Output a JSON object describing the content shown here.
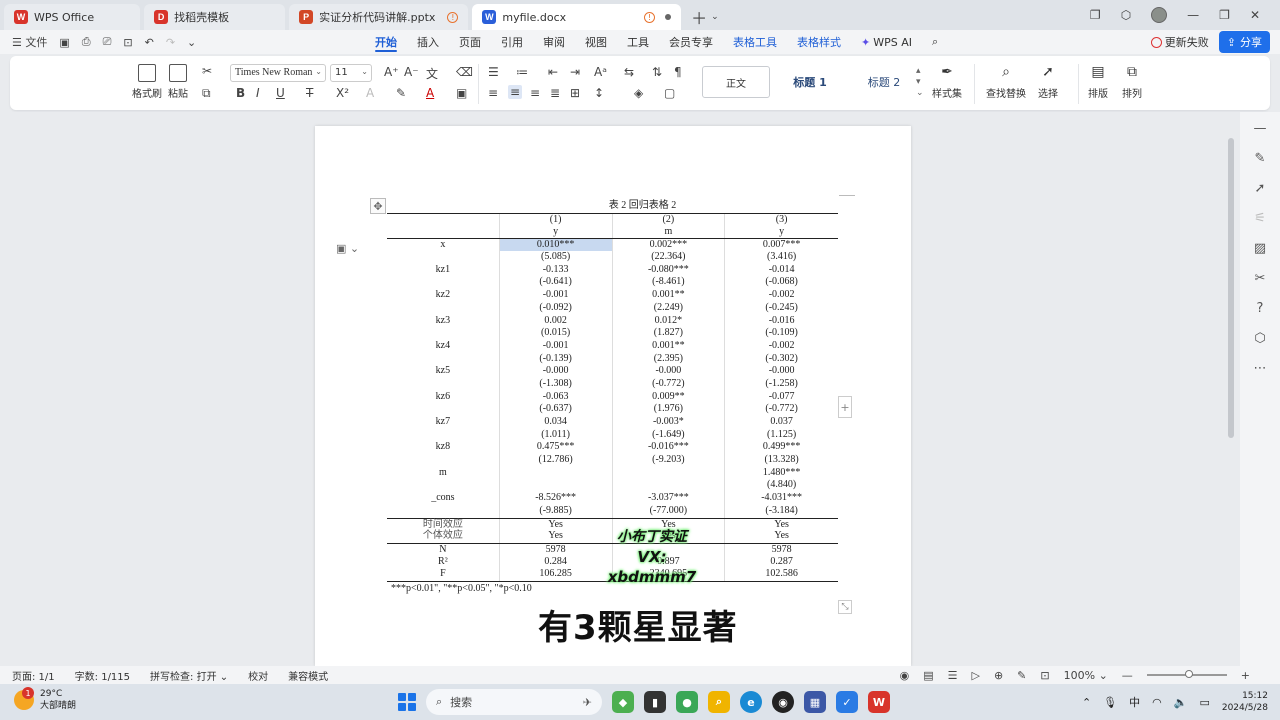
{
  "tabs": [
    {
      "label": "WPS Office",
      "logo": "W",
      "logo_color": "#d8342b",
      "active": false
    },
    {
      "label": "找稻壳模板",
      "logo": "D",
      "logo_color": "#d8342b",
      "active": false
    },
    {
      "label": "实证分析代码讲解.pptx",
      "logo": "P",
      "logo_color": "#d24726",
      "active": false
    },
    {
      "label": "myfile.docx",
      "logo": "W",
      "logo_color": "#2b5fd9",
      "active": true
    }
  ],
  "menu": {
    "file": "文件",
    "tabs": [
      "开始",
      "插入",
      "页面",
      "引用",
      "审阅",
      "视图",
      "工具",
      "会员专享",
      "表格工具",
      "表格样式"
    ],
    "wps_ai": "WPS AI",
    "sync_status": "更新失败",
    "share": "分享"
  },
  "ribbon": {
    "format_painter": "格式刷",
    "paste": "粘贴",
    "font_name": "Times New Roman",
    "font_size": "11",
    "styles": [
      "正文",
      "标题 1",
      "标题 2"
    ],
    "style_set": "样式集",
    "find_replace": "查找替换",
    "select": "选择",
    "layout": "排版",
    "arrange": "排列"
  },
  "table": {
    "title": "表 2 回归表格 2",
    "col_nums": [
      "(1)",
      "(2)",
      "(3)"
    ],
    "dep_vars": [
      "y",
      "m",
      "y"
    ],
    "rows": [
      {
        "label": "x",
        "v": [
          "0.010***",
          "0.002***",
          "0.007***"
        ],
        "t": [
          "(5.085)",
          "(22.364)",
          "(3.416)"
        ]
      },
      {
        "label": "kz1",
        "v": [
          "-0.133",
          "-0.080***",
          "-0.014"
        ],
        "t": [
          "(-0.641)",
          "(-8.461)",
          "(-0.068)"
        ]
      },
      {
        "label": "kz2",
        "v": [
          "-0.001",
          "0.001**",
          "-0.002"
        ],
        "t": [
          "(-0.092)",
          "(2.249)",
          "(-0.245)"
        ]
      },
      {
        "label": "kz3",
        "v": [
          "0.002",
          "0.012*",
          "-0.016"
        ],
        "t": [
          "(0.015)",
          "(1.827)",
          "(-0.109)"
        ]
      },
      {
        "label": "kz4",
        "v": [
          "-0.001",
          "0.001**",
          "-0.002"
        ],
        "t": [
          "(-0.139)",
          "(2.395)",
          "(-0.302)"
        ]
      },
      {
        "label": "kz5",
        "v": [
          "-0.000",
          "-0.000",
          "-0.000"
        ],
        "t": [
          "(-1.308)",
          "(-0.772)",
          "(-1.258)"
        ]
      },
      {
        "label": "kz6",
        "v": [
          "-0.063",
          "0.009**",
          "-0.077"
        ],
        "t": [
          "(-0.637)",
          "(1.976)",
          "(-0.772)"
        ]
      },
      {
        "label": "kz7",
        "v": [
          "0.034",
          "-0.003*",
          "0.037"
        ],
        "t": [
          "(1.011)",
          "(-1.649)",
          "(1.125)"
        ]
      },
      {
        "label": "kz8",
        "v": [
          "0.475***",
          "-0.016***",
          "0.499***"
        ],
        "t": [
          "(12.786)",
          "(-9.203)",
          "(13.328)"
        ]
      },
      {
        "label": "m",
        "v": [
          "",
          "",
          "1.480***"
        ],
        "t": [
          "",
          "",
          "(4.840)"
        ]
      },
      {
        "label": "_cons",
        "v": [
          "-8.526***",
          "-3.037***",
          "-4.031***"
        ],
        "t": [
          "(-9.885)",
          "(-77.000)",
          "(-3.184)"
        ]
      }
    ],
    "effects": [
      {
        "label": "时间效应",
        "v": [
          "Yes",
          "Yes",
          "Yes"
        ]
      },
      {
        "label": "个体效应",
        "v": [
          "Yes",
          "Yes",
          "Yes"
        ]
      }
    ],
    "stats": [
      {
        "label": "N",
        "v": [
          "5978",
          "",
          "5978"
        ]
      },
      {
        "label": "R²",
        "v": [
          "0.284",
          "0.897",
          "0.287"
        ]
      },
      {
        "label": "F",
        "v": [
          "106.285",
          "2340.695",
          "102.586"
        ]
      }
    ],
    "note": "***p<0.01\", \"**p<0.05\", \"*p<0.10"
  },
  "overlay": {
    "caption": "有3颗星显著",
    "watermark_line1": "小布丁实证",
    "watermark_line2": "VX: xbdmmm7"
  },
  "status": {
    "page": "页面: 1/1",
    "words": "字数: 1/115",
    "spell": "拼写检查: 打开",
    "proof": "校对",
    "compat": "兼容模式",
    "zoom": "100%"
  },
  "taskbar": {
    "temp": "29°C",
    "weather": "大部晴朗",
    "weather_badge": "1",
    "search": "搜索",
    "ime": "中",
    "time": "15:12",
    "date": "2024/5/28"
  }
}
